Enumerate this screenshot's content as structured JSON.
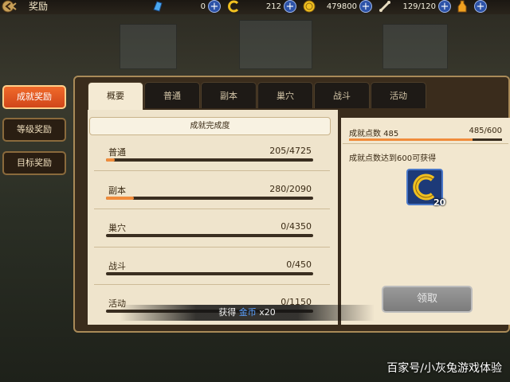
{
  "header": {
    "title": "奖励"
  },
  "resources": [
    {
      "icon": "blue-crystal-icon",
      "value": "0"
    },
    {
      "icon": "gold-c-token-icon",
      "value": "212"
    },
    {
      "icon": "gold-coin-icon",
      "value": "479800"
    },
    {
      "icon": "bone-icon",
      "value": "129/120"
    },
    {
      "icon": "energy-bottle-icon",
      "value": ""
    }
  ],
  "categories": [
    {
      "label": "成就奖励",
      "active": true
    },
    {
      "label": "等级奖励",
      "active": false
    },
    {
      "label": "目标奖励",
      "active": false
    }
  ],
  "tabs": [
    {
      "label": "概要",
      "active": true
    },
    {
      "label": "普通"
    },
    {
      "label": "副本"
    },
    {
      "label": "巢穴"
    },
    {
      "label": "战斗"
    },
    {
      "label": "活动"
    }
  ],
  "overview": {
    "header": "成就完成度",
    "rows": [
      {
        "name": "普通",
        "progress": "205/4725",
        "fraction": 0.0434
      },
      {
        "name": "副本",
        "progress": "280/2090",
        "fraction": 0.134
      },
      {
        "name": "巢穴",
        "progress": "0/4350",
        "fraction": 0
      },
      {
        "name": "战斗",
        "progress": "0/450",
        "fraction": 0
      },
      {
        "name": "活动",
        "progress": "0/1150",
        "fraction": 0
      }
    ]
  },
  "points": {
    "label": "成就点数 485",
    "value": "485/600",
    "fraction": 0.808,
    "goal_text": "成就点数达到600可获得",
    "reward_qty": "20",
    "claim_label": "领取"
  },
  "toast": {
    "prefix": "获得",
    "item": "金币",
    "suffix": "x20"
  },
  "watermark": "百家号/小灰兔游戏体验",
  "colors": {
    "accent": "#f08c3c",
    "active_tab": "#f4ead3",
    "panel_border": "#a98a58"
  }
}
